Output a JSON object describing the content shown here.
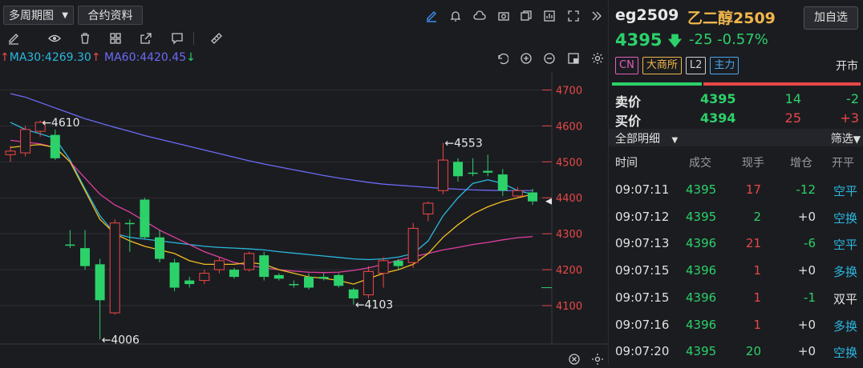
{
  "toolbar": {
    "period_label": "多周期图",
    "contract_label": "合约资料"
  },
  "ma": {
    "ma30_label": "MA30:4269.30",
    "ma60_label": "MA60:4420.45",
    "ma30_color": "#2ab8e0",
    "ma60_color": "#6b6bf5"
  },
  "chart_data": {
    "type": "candlestick",
    "y_ticks": [
      "4700",
      "4600",
      "4500",
      "4400",
      "4300",
      "4200",
      "4100"
    ],
    "ylim": [
      4060,
      4750
    ],
    "annotations": [
      {
        "text": "←4610",
        "value": 4610
      },
      {
        "text": "←4553",
        "value": 4553
      },
      {
        "text": "←4103",
        "value": 4103
      },
      {
        "text": "←4006",
        "value": 4006
      }
    ],
    "candles": [
      {
        "o": 4520,
        "c": 4530,
        "h": 4545,
        "l": 4500
      },
      {
        "o": 4525,
        "c": 4590,
        "h": 4600,
        "l": 4515
      },
      {
        "o": 4585,
        "c": 4610,
        "h": 4615,
        "l": 4570
      },
      {
        "o": 4575,
        "c": 4510,
        "h": 4590,
        "l": 4505
      },
      {
        "o": 4270,
        "c": 4270,
        "h": 4310,
        "l": 4260
      },
      {
        "o": 4260,
        "c": 4210,
        "h": 4310,
        "l": 4200
      },
      {
        "o": 4215,
        "c": 4115,
        "h": 4230,
        "l": 4006
      },
      {
        "o": 4080,
        "c": 4330,
        "h": 4340,
        "l": 4075
      },
      {
        "o": 4330,
        "c": 4330,
        "h": 4340,
        "l": 4250
      },
      {
        "o": 4395,
        "c": 4290,
        "h": 4400,
        "l": 4285
      },
      {
        "o": 4290,
        "c": 4230,
        "h": 4310,
        "l": 4220
      },
      {
        "o": 4220,
        "c": 4150,
        "h": 4230,
        "l": 4140
      },
      {
        "o": 4170,
        "c": 4160,
        "h": 4180,
        "l": 4150
      },
      {
        "o": 4170,
        "c": 4190,
        "h": 4200,
        "l": 4160
      },
      {
        "o": 4200,
        "c": 4225,
        "h": 4235,
        "l": 4190
      },
      {
        "o": 4200,
        "c": 4180,
        "h": 4205,
        "l": 4175
      },
      {
        "o": 4200,
        "c": 4245,
        "h": 4250,
        "l": 4195
      },
      {
        "o": 4240,
        "c": 4180,
        "h": 4250,
        "l": 4170
      },
      {
        "o": 4185,
        "c": 4175,
        "h": 4190,
        "l": 4170
      },
      {
        "o": 4160,
        "c": 4160,
        "h": 4170,
        "l": 4150
      },
      {
        "o": 4180,
        "c": 4150,
        "h": 4190,
        "l": 4145
      },
      {
        "o": 4180,
        "c": 4175,
        "h": 4190,
        "l": 4170
      },
      {
        "o": 4185,
        "c": 4155,
        "h": 4190,
        "l": 4150
      },
      {
        "o": 4145,
        "c": 4120,
        "h": 4150,
        "l": 4103
      },
      {
        "o": 4130,
        "c": 4195,
        "h": 4210,
        "l": 4120
      },
      {
        "o": 4190,
        "c": 4225,
        "h": 4235,
        "l": 4150
      },
      {
        "o": 4225,
        "c": 4210,
        "h": 4230,
        "l": 4200
      },
      {
        "o": 4220,
        "c": 4315,
        "h": 4330,
        "l": 4205
      },
      {
        "o": 4355,
        "c": 4385,
        "h": 4390,
        "l": 4335
      },
      {
        "o": 4420,
        "c": 4505,
        "h": 4553,
        "l": 4410
      },
      {
        "o": 4500,
        "c": 4460,
        "h": 4510,
        "l": 4445
      },
      {
        "o": 4470,
        "c": 4470,
        "h": 4510,
        "l": 4460
      },
      {
        "o": 4475,
        "c": 4470,
        "h": 4520,
        "l": 4460
      },
      {
        "o": 4465,
        "c": 4420,
        "h": 4480,
        "l": 4405
      },
      {
        "o": 4405,
        "c": 4420,
        "h": 4430,
        "l": 4400
      },
      {
        "o": 4415,
        "c": 4390,
        "h": 4425,
        "l": 4380
      }
    ],
    "series": [
      {
        "color": "#6b6bf5",
        "values": [
          4690,
          4680,
          4665,
          4650,
          4635,
          4620,
          4608,
          4596,
          4585,
          4573,
          4563,
          4553,
          4543,
          4533,
          4523,
          4513,
          4503,
          4494,
          4486,
          4478,
          4470,
          4462,
          4455,
          4449,
          4443,
          4438,
          4435,
          4432,
          4429,
          4426,
          4424,
          4422,
          4421,
          4420,
          4420,
          4420
        ]
      },
      {
        "color": "#2ab8e0",
        "values": [
          4610,
          4590,
          4578,
          4565,
          4505,
          4425,
          4350,
          4300,
          4290,
          4285,
          4280,
          4275,
          4270,
          4265,
          4262,
          4260,
          4258,
          4255,
          4250,
          4246,
          4242,
          4238,
          4234,
          4230,
          4228,
          4230,
          4235,
          4245,
          4280,
          4350,
          4400,
          4440,
          4450,
          4440,
          4420,
          4410
        ]
      },
      {
        "color": "#e040a0",
        "values": [
          4560,
          4555,
          4550,
          4540,
          4500,
          4455,
          4410,
          4380,
          4360,
          4335,
          4310,
          4290,
          4270,
          4250,
          4235,
          4220,
          4212,
          4205,
          4200,
          4196,
          4193,
          4192,
          4193,
          4198,
          4205,
          4215,
          4226,
          4236,
          4245,
          4255,
          4262,
          4270,
          4276,
          4283,
          4289,
          4292
        ]
      },
      {
        "color": "#f0c020",
        "values": [
          4540,
          4545,
          4548,
          4540,
          4500,
          4420,
          4340,
          4300,
          4280,
          4265,
          4255,
          4245,
          4225,
          4215,
          4215,
          4215,
          4220,
          4215,
          4200,
          4190,
          4180,
          4176,
          4170,
          4160,
          4175,
          4190,
          4200,
          4215,
          4245,
          4290,
          4325,
          4355,
          4375,
          4390,
          4400,
          4410
        ]
      }
    ]
  },
  "quote": {
    "code": "eg2509",
    "name": "乙二醇2509",
    "add_label": "加自选",
    "price": "4395",
    "change": "-25",
    "change_pct": "-0.57%",
    "tags": [
      "CN",
      "大商所",
      "L2",
      "主力"
    ],
    "status": "开市"
  },
  "orderbook": {
    "ask": {
      "label": "卖价",
      "price": "4395",
      "vol": "14",
      "chg": "-2"
    },
    "bid": {
      "label": "买价",
      "price": "4394",
      "vol": "25",
      "chg": "+3"
    }
  },
  "filter": {
    "label": "全部明细",
    "filter_label": "筛选"
  },
  "ticks": {
    "headers": [
      "时间",
      "成交",
      "现手",
      "增仓",
      "开平"
    ],
    "rows": [
      {
        "time": "09:07:11",
        "price": "4395",
        "vol": "17",
        "oi": "-12",
        "type": "空平",
        "vc": "#e84848",
        "oc": "#2cd16a",
        "tc": "#2ab8e0"
      },
      {
        "time": "09:07:12",
        "price": "4395",
        "vol": "2",
        "oi": "+0",
        "type": "空换",
        "vc": "#2cd16a",
        "oc": "#e0e0e0",
        "tc": "#2ab8e0"
      },
      {
        "time": "09:07:13",
        "price": "4396",
        "vol": "21",
        "oi": "-6",
        "type": "空平",
        "vc": "#e84848",
        "oc": "#2cd16a",
        "tc": "#2ab8e0"
      },
      {
        "time": "09:07:15",
        "price": "4396",
        "vol": "1",
        "oi": "+0",
        "type": "多换",
        "vc": "#e84848",
        "oc": "#e0e0e0",
        "tc": "#2ab8e0"
      },
      {
        "time": "09:07:15",
        "price": "4396",
        "vol": "1",
        "oi": "-1",
        "type": "双平",
        "vc": "#e84848",
        "oc": "#2cd16a",
        "tc": "#e0e0e0"
      },
      {
        "time": "09:07:16",
        "price": "4396",
        "vol": "1",
        "oi": "+0",
        "type": "多换",
        "vc": "#e84848",
        "oc": "#e0e0e0",
        "tc": "#2ab8e0"
      },
      {
        "time": "09:07:20",
        "price": "4395",
        "vol": "20",
        "oi": "+0",
        "type": "空换",
        "vc": "#2cd16a",
        "oc": "#e0e0e0",
        "tc": "#2ab8e0"
      }
    ]
  }
}
